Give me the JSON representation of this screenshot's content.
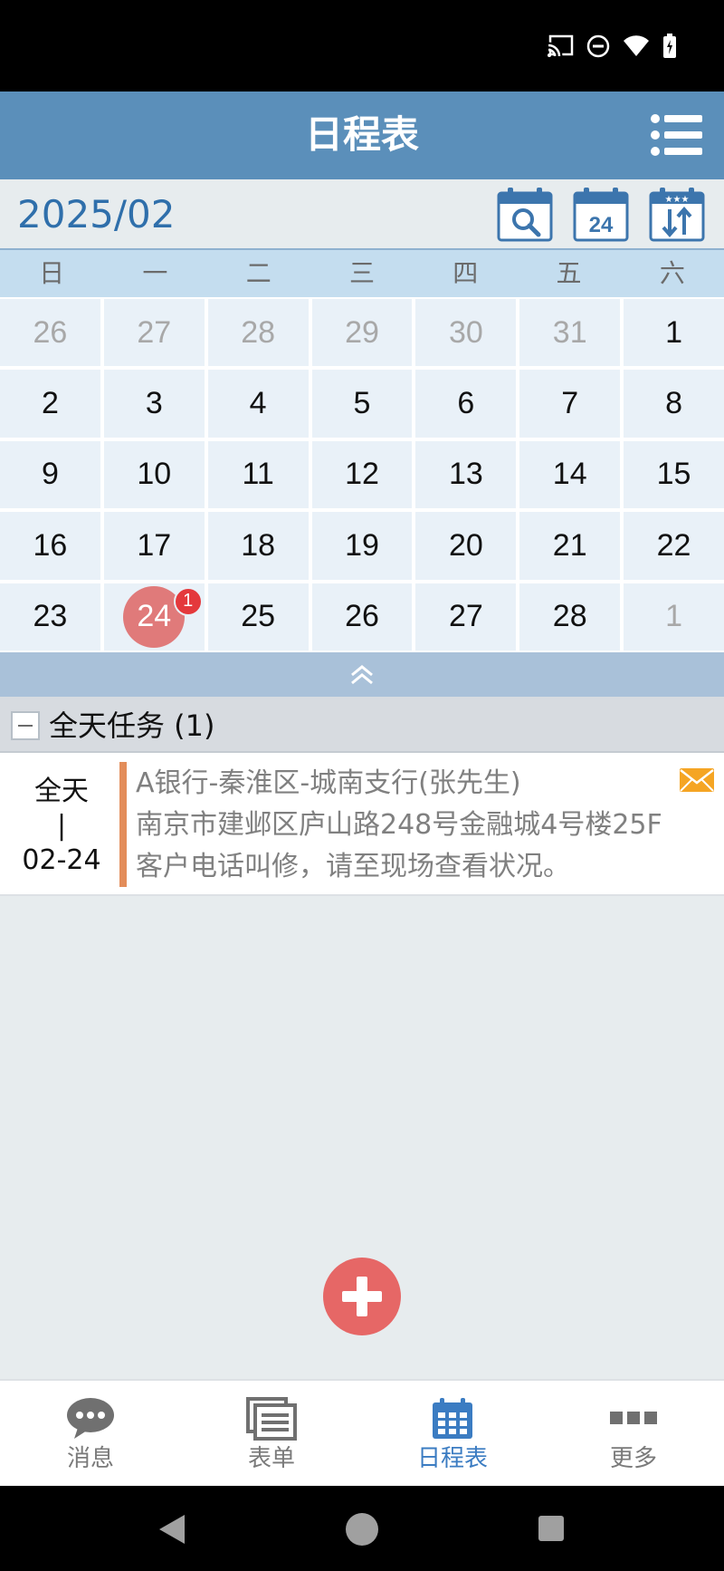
{
  "header": {
    "title": "日程表",
    "menu_icon": "list-menu-icon"
  },
  "calendar": {
    "month_label": "2025/02",
    "tools": [
      "calendar-search-icon",
      "calendar-today-icon",
      "calendar-sort-icon"
    ],
    "today_tool_label": "24",
    "weekdays": [
      "日",
      "一",
      "二",
      "三",
      "四",
      "五",
      "六"
    ],
    "weeks": [
      [
        "26",
        "27",
        "28",
        "29",
        "30",
        "31",
        "1"
      ],
      [
        "2",
        "3",
        "4",
        "5",
        "6",
        "7",
        "8"
      ],
      [
        "9",
        "10",
        "11",
        "12",
        "13",
        "14",
        "15"
      ],
      [
        "16",
        "17",
        "18",
        "19",
        "20",
        "21",
        "22"
      ],
      [
        "23",
        "24",
        "25",
        "26",
        "27",
        "28",
        "1"
      ]
    ],
    "muted_cells": [
      [
        0,
        0
      ],
      [
        0,
        1
      ],
      [
        0,
        2
      ],
      [
        0,
        3
      ],
      [
        0,
        4
      ],
      [
        0,
        5
      ],
      [
        4,
        6
      ]
    ],
    "today": {
      "week": 4,
      "day": 1,
      "badge": "1"
    },
    "today_color": "#e07a7a"
  },
  "section": {
    "title": "全天任务 (1)"
  },
  "task": {
    "time_top": "全天",
    "time_sep": "|",
    "time_date": "02-24",
    "title": "A银行-秦淮区-城南支行(张先生)",
    "address": "南京市建邺区庐山路248号金融城4号楼25F",
    "description": "客户电话叫修，请至现场查看状况。",
    "accent_color": "#e38d5a"
  },
  "bottom_nav": [
    {
      "label": "消息",
      "icon": "chat-bubble-icon",
      "active": false
    },
    {
      "label": "表单",
      "icon": "forms-icon",
      "active": false
    },
    {
      "label": "日程表",
      "icon": "calendar-grid-icon",
      "active": true
    },
    {
      "label": "更多",
      "icon": "more-dots-icon",
      "active": false
    }
  ],
  "colors": {
    "header": "#5b8fba",
    "active_nav": "#3b7cc2",
    "fab": "#e66766"
  }
}
